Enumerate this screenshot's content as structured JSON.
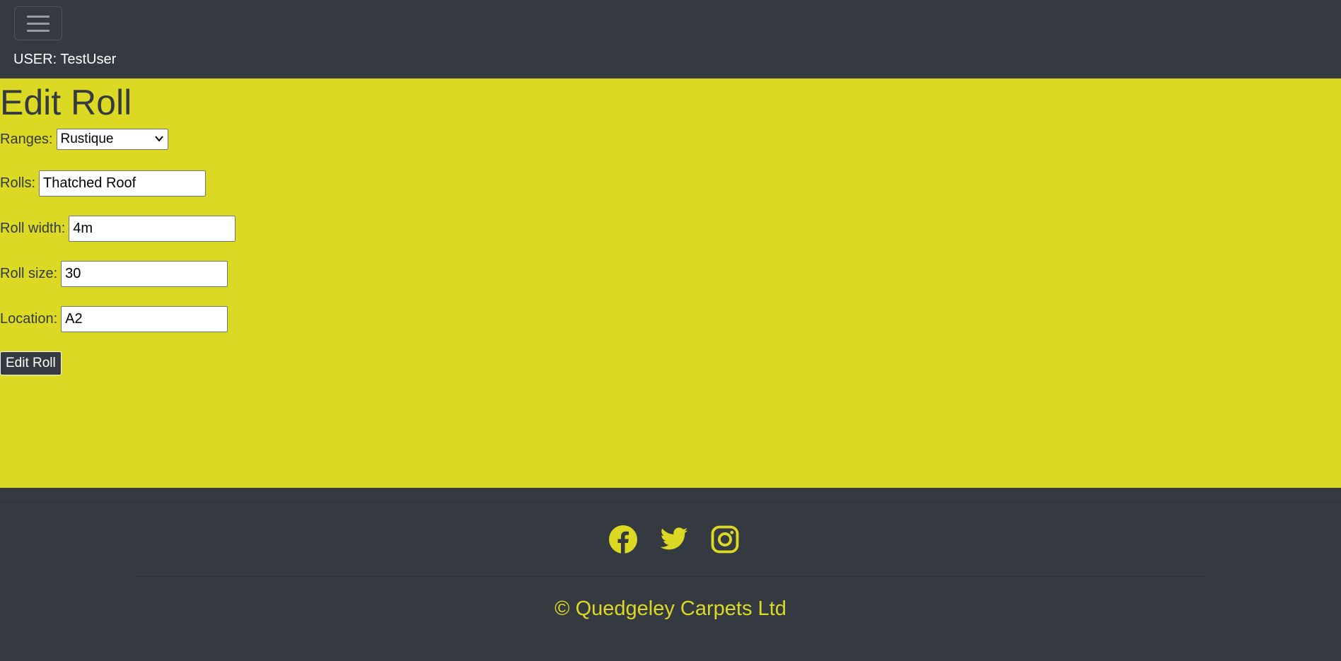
{
  "header": {
    "menu_toggle_icon": "hamburger-menu-icon",
    "user_label": "USER: TestUser"
  },
  "main": {
    "title": "Edit Roll",
    "ranges": {
      "label": "Ranges:",
      "selected": "Rustique"
    },
    "rolls": {
      "label": "Rolls:",
      "value": "Thatched Roof"
    },
    "roll_width": {
      "label": "Roll width:",
      "value": "4m"
    },
    "roll_size": {
      "label": "Roll size:",
      "value": "30"
    },
    "location": {
      "label": "Location:",
      "value": "A2"
    },
    "submit_label": "Edit Roll"
  },
  "footer": {
    "social_icons": [
      "facebook-icon",
      "twitter-icon",
      "instagram-icon"
    ],
    "copyright": "© Quedgeley Carpets Ltd"
  },
  "colors": {
    "dark": "#343a40",
    "accent": "#dbd924",
    "text_light": "#ffffff"
  }
}
